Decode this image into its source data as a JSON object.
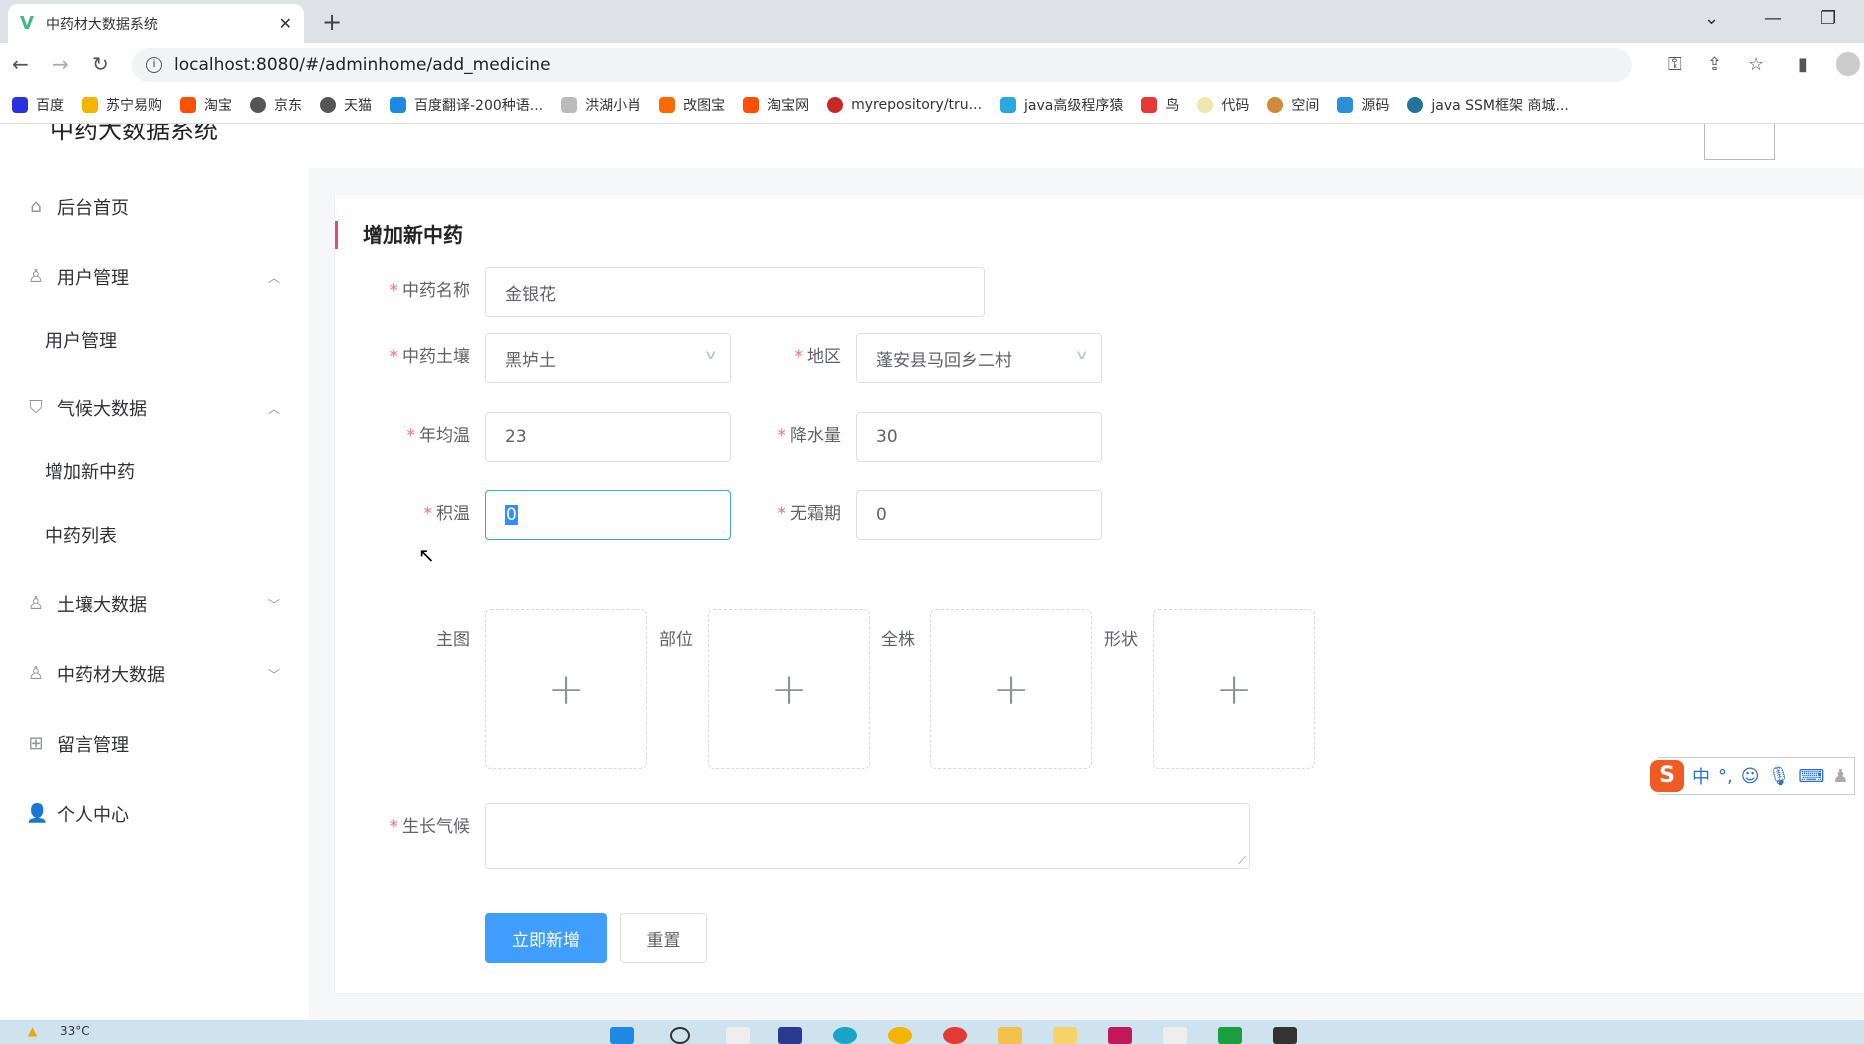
{
  "browser": {
    "tab_title": "中药材大数据系统",
    "url": "localhost:8080/#/adminhome/add_medicine",
    "bookmarks": [
      "百度",
      "苏宁易购",
      "淘宝",
      "京东",
      "天猫",
      "百度翻译-200种语...",
      "洪湖小肖",
      "改图宝",
      "淘宝网",
      "myrepository/tru...",
      "java高级程序猿",
      "鸟",
      "代码",
      "空间",
      "源码",
      "java SSM框架 商城..."
    ]
  },
  "app": {
    "title": "中药大数据系统"
  },
  "sidebar": {
    "items": [
      {
        "label": "后台首页",
        "icon": "home-icon"
      },
      {
        "label": "用户管理",
        "icon": "user-icon"
      },
      {
        "label": "用户管理",
        "sub": true
      },
      {
        "label": "气候大数据",
        "icon": "bag-icon"
      },
      {
        "label": "增加新中药",
        "sub": true
      },
      {
        "label": "中药列表",
        "sub": true
      },
      {
        "label": "土壤大数据",
        "icon": "user-icon"
      },
      {
        "label": "中药材大数据",
        "icon": "user-icon"
      },
      {
        "label": "留言管理",
        "icon": "gift-icon"
      },
      {
        "label": "个人中心",
        "icon": "person-icon"
      }
    ]
  },
  "form": {
    "title": "增加新中药",
    "required_mark": "*",
    "name": {
      "label": "中药名称",
      "value": "金银花"
    },
    "soil": {
      "label": "中药土壤",
      "value": "黑垆土"
    },
    "region": {
      "label": "地区",
      "value": "蓬安县马回乡二村"
    },
    "avg_temp": {
      "label": "年均温",
      "value": "23"
    },
    "rainfall": {
      "label": "降水量",
      "value": "30"
    },
    "acc_temp": {
      "label": "积温",
      "value": "0"
    },
    "frost_free": {
      "label": "无霜期",
      "value": "0"
    },
    "uploads": [
      "主图",
      "部位",
      "全株",
      "形状"
    ],
    "climate": {
      "label": "生长气候",
      "value": ""
    },
    "submit": "立即新增",
    "reset": "重置"
  },
  "ime": {
    "mode": "中",
    "punct": "°,"
  },
  "taskbar": {
    "weather": "33°C"
  }
}
